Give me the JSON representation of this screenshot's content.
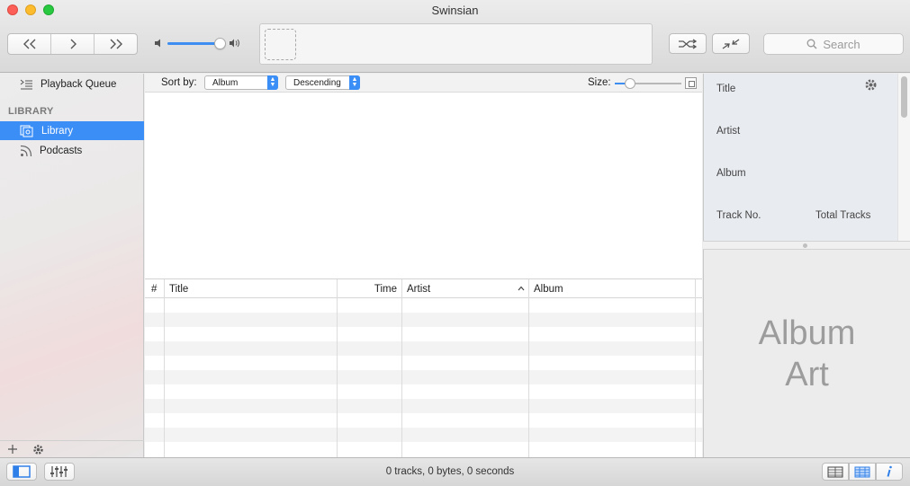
{
  "window": {
    "title": "Swinsian"
  },
  "toolbar": {
    "prev_label": "«",
    "play_label": "›",
    "next_label": "»",
    "search_placeholder": "Search",
    "volume_level_percent": 85
  },
  "sidebar": {
    "items": [
      {
        "label": "Playback Queue",
        "icon": "playback-queue-icon"
      },
      {
        "label": "Library",
        "icon": "library-icon",
        "selected": true
      },
      {
        "label": "Podcasts",
        "icon": "podcast-icon"
      }
    ],
    "section_header": "LIBRARY"
  },
  "sortbar": {
    "sort_label": "Sort by:",
    "sort_field": "Album",
    "sort_order": "Descending",
    "size_label": "Size:",
    "size_level_percent": 15
  },
  "table": {
    "columns": [
      "#",
      "Title",
      "Time",
      "Artist",
      "Album"
    ],
    "sorted_column": "Artist",
    "sort_direction": "ascending",
    "rows": []
  },
  "info": {
    "title_label": "Title",
    "artist_label": "Artist",
    "album_label": "Album",
    "track_no_label": "Track No.",
    "total_tracks_label": "Total Tracks"
  },
  "art": {
    "placeholder": "Album Art"
  },
  "status": {
    "text": "0 tracks,  0 bytes,  0 seconds"
  },
  "colors": {
    "accent": "#3b8ef5"
  }
}
